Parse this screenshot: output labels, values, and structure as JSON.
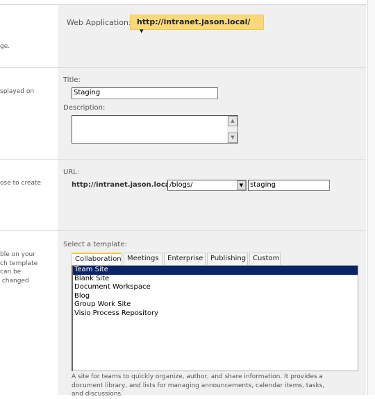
{
  "left_fragments": {
    "web_app": "ge.",
    "title": "splayed on",
    "url": "ose to create",
    "template": [
      "ble on your",
      "ch template",
      "can be",
      " changed"
    ]
  },
  "web_application": {
    "label": "Web Application:",
    "value": "http://intranet.jason.local/",
    "arrow": "▾"
  },
  "title": {
    "label": "Title:",
    "value": "Staging"
  },
  "description": {
    "label": "Description:",
    "value": ""
  },
  "url": {
    "label": "URL:",
    "prefix": "http://intranet.jason.local",
    "path_select": "/blogs/",
    "name_value": "staging"
  },
  "template": {
    "label": "Select a template:",
    "tabs": [
      "Collaboration",
      "Meetings",
      "Enterprise",
      "Publishing",
      "Custom"
    ],
    "active_tab": "Collaboration",
    "items": [
      "Team Site",
      "Blank Site",
      "Document Workspace",
      "Blog",
      "Group Work Site",
      "Visio Process Repository"
    ],
    "selected": "Team Site",
    "description": "A site for teams to quickly organize, author, and share information. It provides a document library, and lists for managing announcements, calendar items, tasks, and discussions."
  },
  "colors": {
    "button_bg": "#fbd97a",
    "selection": "#0a2468",
    "panel": "#f0f0f0"
  }
}
